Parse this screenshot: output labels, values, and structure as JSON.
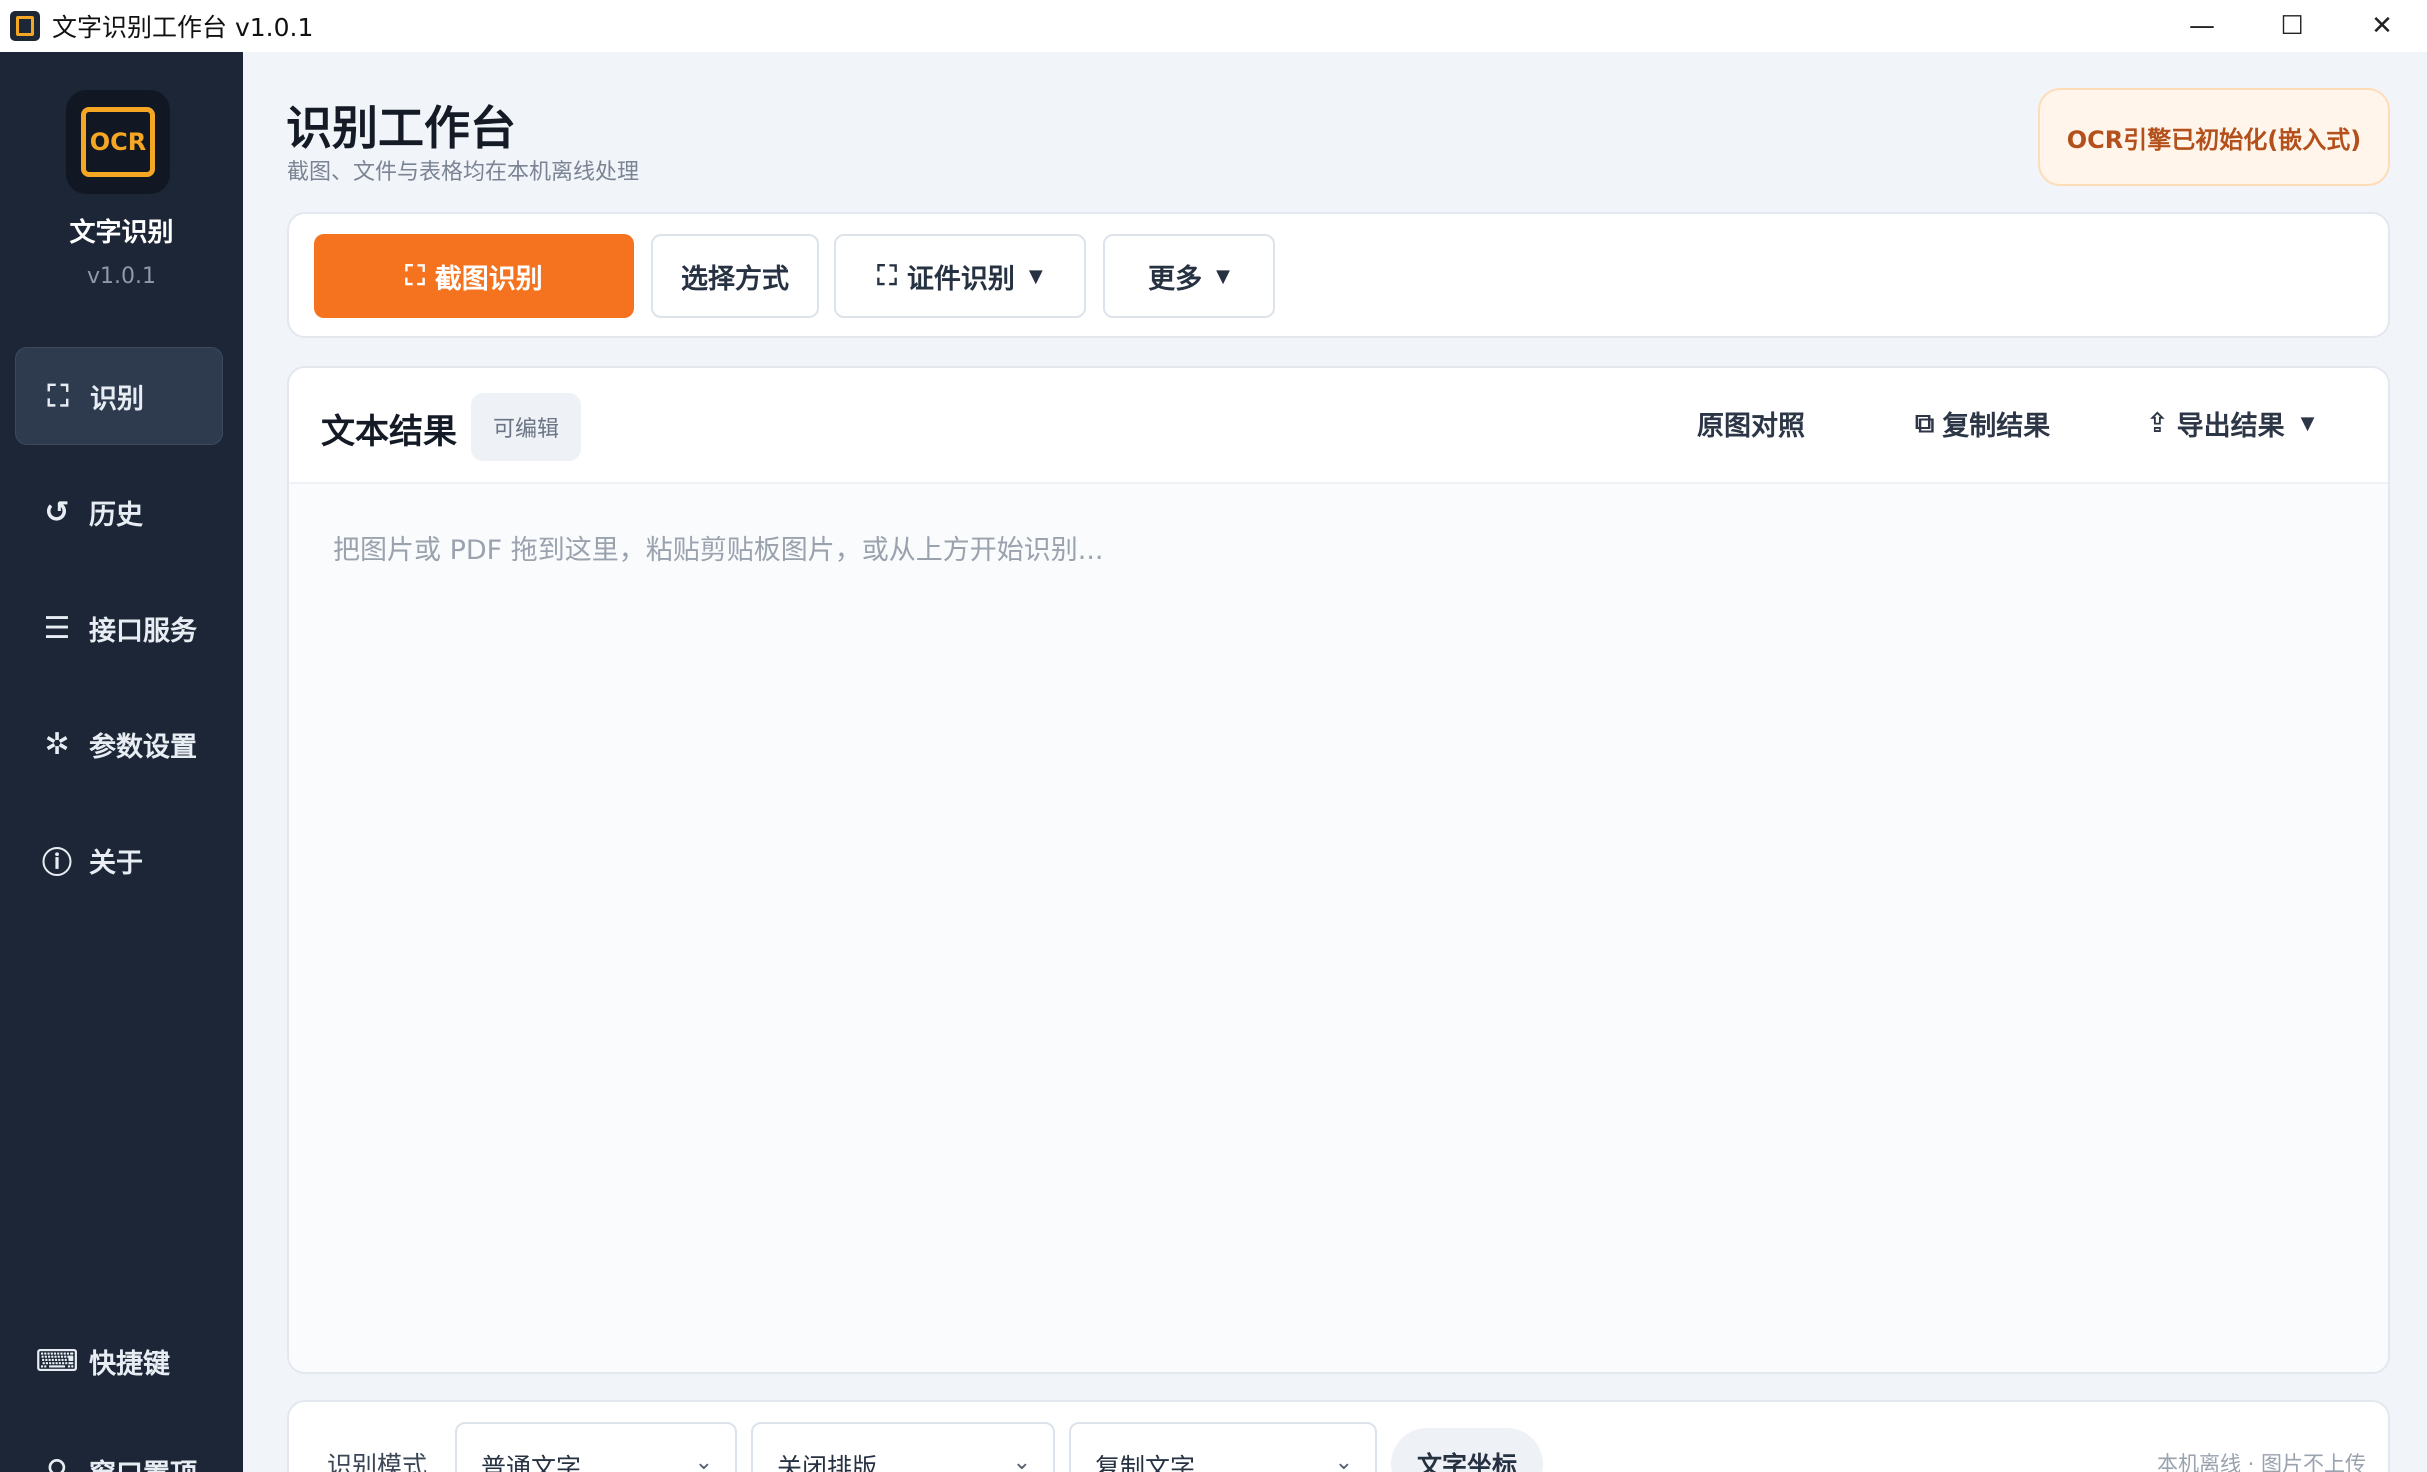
{
  "window": {
    "title": "文字识别工作台 v1.0.1",
    "controls": {
      "minimize": "—",
      "maximize": "☐",
      "close": "✕"
    }
  },
  "sidebar": {
    "logo_text": "OCR",
    "brand_name": "文字识别",
    "version": "v1.0.1",
    "items": [
      {
        "label": "识别",
        "icon": "scan-icon",
        "glyph": "⛶",
        "active": true
      },
      {
        "label": "历史",
        "icon": "history-icon",
        "glyph": "↺",
        "active": false
      },
      {
        "label": "接口服务",
        "icon": "server-icon",
        "glyph": "☰",
        "active": false
      },
      {
        "label": "参数设置",
        "icon": "settings-icon",
        "glyph": "✲",
        "active": false
      },
      {
        "label": "关于",
        "icon": "info-icon",
        "glyph": "ⓘ",
        "active": false
      }
    ],
    "bottom_items": [
      {
        "label": "快捷键",
        "icon": "keyboard-icon",
        "glyph": "⌨"
      },
      {
        "label": "窗口置顶",
        "icon": "pin-icon",
        "glyph": "⚲"
      }
    ]
  },
  "header": {
    "title": "识别工作台",
    "subtitle": "截图、文件与表格均在本机离线处理",
    "engine_status": "OCR引擎已初始化(嵌入式)"
  },
  "toolbar": {
    "screenshot_label": "截图识别",
    "screenshot_icon": "⛶",
    "choose_label": "选择方式",
    "id_label": "证件识别",
    "id_icon": "⛶",
    "more_label": "更多",
    "caret": "▼"
  },
  "result": {
    "title": "文本结果",
    "editable_tag": "可编辑",
    "compare_label": "原图对照",
    "copy_label": "复制结果",
    "copy_icon": "⧉",
    "export_label": "导出结果",
    "export_icon": "⇪",
    "caret": "▼",
    "placeholder": "把图片或 PDF 拖到这里，粘贴剪贴板图片，或从上方开始识别..."
  },
  "bottom": {
    "mode_label": "识别模式",
    "mode_value": "普通文字",
    "layout_value": "关闭排版",
    "copy_value": "复制文字",
    "coord_label": "文字坐标",
    "offline_note": "本机离线 · 图片不上传",
    "chevron": "⌄"
  },
  "colors": {
    "accent": "#f5731e",
    "sidebar_bg": "#1c2636",
    "logo_accent": "#f5a623",
    "badge_text": "#b3501b"
  }
}
